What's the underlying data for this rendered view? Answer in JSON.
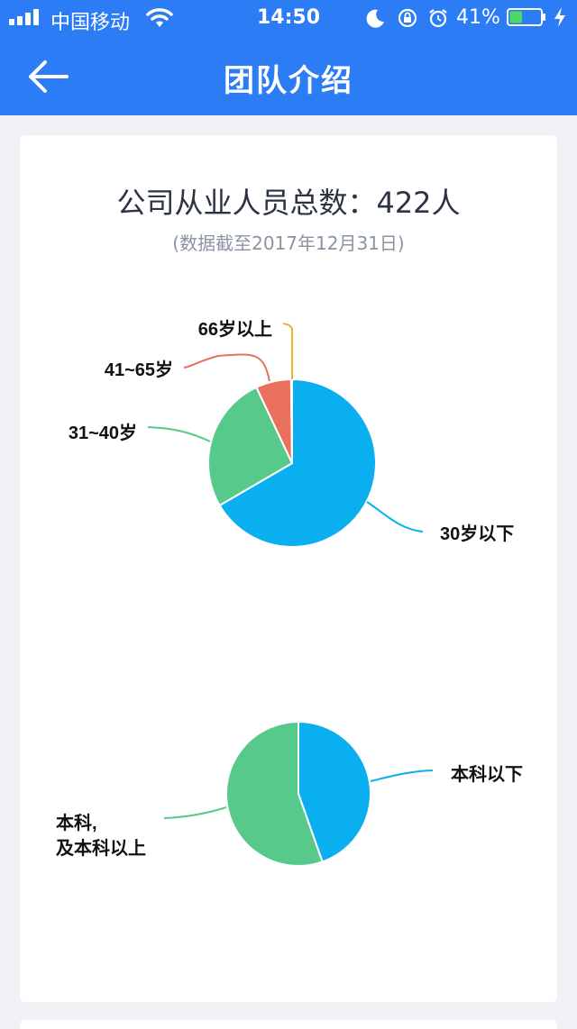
{
  "status_bar": {
    "carrier": "中国移动",
    "time": "14:50",
    "battery": "41%",
    "battery_level": 0.41
  },
  "nav": {
    "title": "团队介绍",
    "back_icon": "back-arrow-icon"
  },
  "card": {
    "title": "公司从业人员总数：422人",
    "subtitle": "(数据截至2017年12月31日)"
  },
  "colors": {
    "header": "#2c7cf6",
    "blue": "#0aaff0",
    "green": "#57c98b",
    "red": "#e9705f",
    "orange": "#f0b12a"
  },
  "chart_data": [
    {
      "type": "pie",
      "title": "",
      "slices": [
        {
          "label": "30岁以下",
          "value": 0.666,
          "color": "#0aaff0"
        },
        {
          "label": "31~40岁",
          "value": 0.264,
          "color": "#57c98b"
        },
        {
          "label": "41~65岁",
          "value": 0.068,
          "color": "#e9705f"
        },
        {
          "label": "66岁以上",
          "value": 0.002,
          "color": "#f0b12a"
        }
      ]
    },
    {
      "type": "pie",
      "title": "",
      "slices": [
        {
          "label": "本科以下",
          "value": 0.446,
          "color": "#0aaff0"
        },
        {
          "label_lines": [
            "本科,",
            "及本科以上"
          ],
          "value": 0.554,
          "color": "#57c98b"
        }
      ]
    }
  ]
}
